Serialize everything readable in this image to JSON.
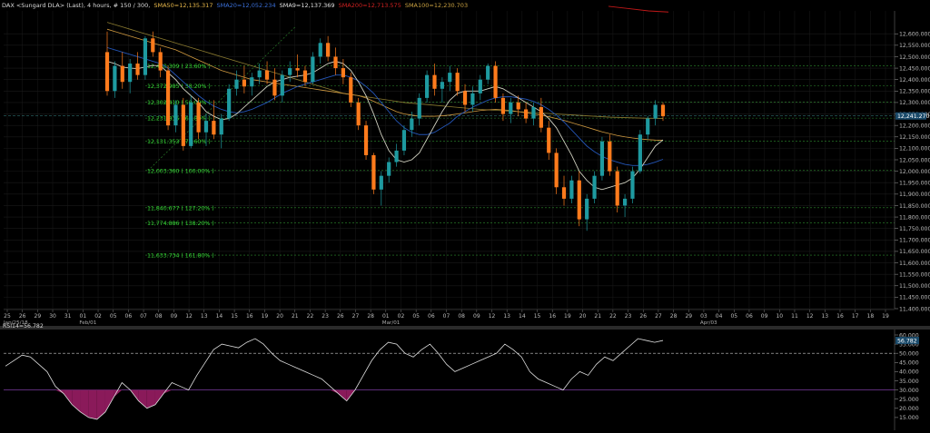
{
  "header": {
    "parts": [
      {
        "text": "DAX <Sungard DLA> (Last), 4 hours, # 150 / 300,",
        "color": "#d8d8d8"
      },
      {
        "text": "SMA50=12,135.317",
        "color": "#e8b84a"
      },
      {
        "text": "SMA20=12,052.234",
        "color": "#3a6fd8"
      },
      {
        "text": "SMA9=12,137.369",
        "color": "#e0e0e0"
      },
      {
        "text": "SMA200=12,713.575",
        "color": "#d02020"
      },
      {
        "text": "SMA100=12,230.703",
        "color": "#c8a040"
      }
    ]
  },
  "colors": {
    "bull": "#1e9aa0",
    "bear": "#ff7b1c",
    "sma9": "#d0d0c0",
    "sma20": "#2456b8",
    "sma50": "#d09a40",
    "sma100": "#8a7a30",
    "sma200": "#c01818",
    "fib": "#2e8b2e",
    "fib_label": "#36d636",
    "grid": "#1a1a1a",
    "rsi": "#e0e0e0",
    "rsi_fill": "#8a1a5a",
    "rsi_level": "#7a3aa0"
  },
  "chart_data": [
    {
      "type": "candlestick",
      "title": "DAX <Sungard DLA> (Last), 4 hours",
      "ylim": [
        11400,
        12700
      ],
      "y_ticks": [
        11400,
        11450,
        11500,
        11550,
        11600,
        11650,
        11700,
        11750,
        11800,
        11850,
        11900,
        11950,
        12000,
        12050,
        12100,
        12150,
        12200,
        12250,
        12300,
        12350,
        12400,
        12450,
        12500,
        12550,
        12600
      ],
      "y_tick_labels": [
        "11,400.000",
        "11,450.000",
        "11,500.000",
        "11,550.000",
        "11,600.000",
        "11,650.000",
        "11,700.000",
        "11,750.000",
        "11,800.000",
        "11,850.000",
        "11,900.000",
        "11,950.000",
        "12,000.000",
        "12,050.000",
        "12,100.000",
        "12,150.000",
        "12,200.000",
        "12,250.000",
        "12,300.000",
        "12,350.000",
        "12,400.000",
        "12,450.000",
        "12,500.000",
        "12,550.000",
        "12,600.000"
      ],
      "last_price": 12241.27,
      "last_price_label": "12,241.270",
      "x_day_labels": [
        "25",
        "26",
        "29",
        "30",
        "31",
        "01",
        "02",
        "05",
        "06",
        "07",
        "08",
        "09",
        "12",
        "13",
        "14",
        "15",
        "16",
        "19",
        "20",
        "21",
        "22",
        "23",
        "26",
        "27",
        "28",
        "01",
        "02",
        "05",
        "06",
        "07",
        "08",
        "09",
        "12",
        "13",
        "14",
        "15",
        "16",
        "19",
        "20",
        "21",
        "22",
        "23",
        "26",
        "27",
        "28",
        "29",
        "03",
        "04",
        "05",
        "06",
        "09",
        "10",
        "11",
        "12",
        "13",
        "16",
        "17",
        "18",
        "19"
      ],
      "x_month_labels": [
        {
          "text": "Jan/25/18",
          "day_index": 0
        },
        {
          "text": "Feb/01",
          "day_index": 5
        },
        {
          "text": "Mar/01",
          "day_index": 25
        },
        {
          "text": "Apr/03",
          "day_index": 46
        }
      ],
      "fib_levels": [
        {
          "price": 12460.309,
          "label": "12,460.309 ( 23.60% )"
        },
        {
          "price": 12372.985,
          "label": "12,372.985 ( 38.20% )"
        },
        {
          "price": 12302.41,
          "label": "12,302.410 ( 50.00% )"
        },
        {
          "price": 12231.835,
          "label": "12,231.835 ( 61.80% )"
        },
        {
          "price": 12131.353,
          "label": "12,131.353 ( 78.60% )"
        },
        {
          "price": 12003.36,
          "label": "12,003.360 ( 100.00% )"
        },
        {
          "price": 11840.677,
          "label": "11,840.677 ( 127.20% )"
        },
        {
          "price": 11774.886,
          "label": "11,774.886 ( 138.20% )"
        },
        {
          "price": 11633.734,
          "label": "11,633.734 ( 161.80% )"
        }
      ],
      "candles": [
        [
          12520,
          12610,
          12330,
          12350
        ],
        [
          12350,
          12480,
          12320,
          12460
        ],
        [
          12460,
          12520,
          12360,
          12390
        ],
        [
          12390,
          12490,
          12340,
          12470
        ],
        [
          12470,
          12520,
          12400,
          12420
        ],
        [
          12420,
          12590,
          12400,
          12580
        ],
        [
          12580,
          12610,
          12500,
          12520
        ],
        [
          12520,
          12540,
          12410,
          12440
        ],
        [
          12440,
          12460,
          12180,
          12200
        ],
        [
          12200,
          12310,
          12170,
          12290
        ],
        [
          12290,
          12320,
          12090,
          12110
        ],
        [
          12110,
          12330,
          12100,
          12300
        ],
        [
          12300,
          12320,
          12140,
          12170
        ],
        [
          12170,
          12250,
          12110,
          12220
        ],
        [
          12220,
          12310,
          12140,
          12160
        ],
        [
          12160,
          12250,
          12100,
          12230
        ],
        [
          12230,
          12380,
          12220,
          12360
        ],
        [
          12360,
          12440,
          12330,
          12400
        ],
        [
          12400,
          12460,
          12340,
          12370
        ],
        [
          12370,
          12430,
          12330,
          12410
        ],
        [
          12410,
          12470,
          12380,
          12440
        ],
        [
          12440,
          12480,
          12380,
          12400
        ],
        [
          12400,
          12450,
          12310,
          12330
        ],
        [
          12330,
          12440,
          12300,
          12420
        ],
        [
          12420,
          12480,
          12390,
          12450
        ],
        [
          12450,
          12510,
          12410,
          12440
        ],
        [
          12440,
          12460,
          12370,
          12390
        ],
        [
          12390,
          12520,
          12380,
          12500
        ],
        [
          12500,
          12580,
          12470,
          12560
        ],
        [
          12560,
          12590,
          12480,
          12500
        ],
        [
          12500,
          12540,
          12420,
          12450
        ],
        [
          12450,
          12490,
          12380,
          12410
        ],
        [
          12410,
          12430,
          12280,
          12300
        ],
        [
          12300,
          12320,
          12180,
          12200
        ],
        [
          12200,
          12220,
          12050,
          12070
        ],
        [
          12070,
          12080,
          11900,
          11920
        ],
        [
          11920,
          12000,
          11850,
          11980
        ],
        [
          11980,
          12060,
          11950,
          12040
        ],
        [
          12040,
          12120,
          12020,
          12090
        ],
        [
          12090,
          12200,
          12070,
          12180
        ],
        [
          12180,
          12260,
          12150,
          12230
        ],
        [
          12230,
          12340,
          12200,
          12320
        ],
        [
          12320,
          12440,
          12300,
          12420
        ],
        [
          12420,
          12470,
          12330,
          12360
        ],
        [
          12360,
          12410,
          12300,
          12390
        ],
        [
          12390,
          12460,
          12350,
          12430
        ],
        [
          12430,
          12450,
          12330,
          12350
        ],
        [
          12350,
          12380,
          12260,
          12290
        ],
        [
          12290,
          12370,
          12260,
          12340
        ],
        [
          12340,
          12420,
          12310,
          12400
        ],
        [
          12400,
          12470,
          12380,
          12460
        ],
        [
          12460,
          12480,
          12300,
          12320
        ],
        [
          12320,
          12340,
          12220,
          12250
        ],
        [
          12250,
          12320,
          12210,
          12300
        ],
        [
          12300,
          12330,
          12240,
          12270
        ],
        [
          12270,
          12300,
          12210,
          12230
        ],
        [
          12230,
          12300,
          12200,
          12280
        ],
        [
          12280,
          12320,
          12170,
          12190
        ],
        [
          12190,
          12220,
          12050,
          12080
        ],
        [
          12080,
          12100,
          11900,
          11930
        ],
        [
          11930,
          11980,
          11850,
          11880
        ],
        [
          11880,
          11980,
          11860,
          11960
        ],
        [
          11960,
          12000,
          11760,
          11790
        ],
        [
          11790,
          11900,
          11740,
          11880
        ],
        [
          11880,
          12000,
          11860,
          11980
        ],
        [
          11980,
          12150,
          11960,
          12130
        ],
        [
          12130,
          12160,
          11980,
          12000
        ],
        [
          12000,
          12020,
          11820,
          11850
        ],
        [
          11850,
          11900,
          11800,
          11880
        ],
        [
          11880,
          12020,
          11860,
          12000
        ],
        [
          12000,
          12180,
          11990,
          12160
        ],
        [
          12160,
          12240,
          12140,
          12230
        ],
        [
          12230,
          12310,
          12200,
          12290
        ],
        [
          12290,
          12300,
          12220,
          12240
        ]
      ],
      "sma9": [
        12480,
        12470,
        12455,
        12450,
        12448,
        12455,
        12462,
        12460,
        12430,
        12400,
        12360,
        12330,
        12300,
        12260,
        12240,
        12225,
        12230,
        12250,
        12280,
        12310,
        12340,
        12370,
        12390,
        12400,
        12410,
        12415,
        12420,
        12430,
        12450,
        12470,
        12480,
        12470,
        12440,
        12390,
        12330,
        12250,
        12160,
        12090,
        12050,
        12040,
        12050,
        12080,
        12140,
        12200,
        12260,
        12310,
        12340,
        12350,
        12350,
        12350,
        12360,
        12370,
        12360,
        12340,
        12320,
        12300,
        12280,
        12260,
        12230,
        12190,
        12130,
        12070,
        12000,
        11960,
        11930,
        11920,
        11930,
        11940,
        11950,
        11970,
        12010,
        12060,
        12110,
        12137
      ],
      "sma20": [
        12540,
        12530,
        12520,
        12510,
        12500,
        12490,
        12480,
        12470,
        12450,
        12420,
        12390,
        12360,
        12330,
        12305,
        12285,
        12270,
        12260,
        12255,
        12260,
        12270,
        12285,
        12300,
        12320,
        12340,
        12355,
        12370,
        12380,
        12390,
        12400,
        12410,
        12420,
        12420,
        12410,
        12395,
        12370,
        12340,
        12300,
        12260,
        12220,
        12190,
        12170,
        12160,
        12160,
        12170,
        12190,
        12210,
        12240,
        12260,
        12280,
        12295,
        12310,
        12320,
        12325,
        12325,
        12320,
        12315,
        12305,
        12290,
        12270,
        12245,
        12215,
        12180,
        12145,
        12110,
        12085,
        12065,
        12050,
        12040,
        12030,
        12025,
        12025,
        12030,
        12040,
        12052
      ],
      "sma50": [
        12620,
        12610,
        12600,
        12590,
        12580,
        12570,
        12560,
        12550,
        12540,
        12530,
        12515,
        12500,
        12485,
        12470,
        12455,
        12440,
        12430,
        12420,
        12410,
        12400,
        12395,
        12390,
        12385,
        12380,
        12375,
        12370,
        12365,
        12360,
        12355,
        12350,
        12345,
        12340,
        12335,
        12330,
        12320,
        12305,
        12290,
        12275,
        12260,
        12250,
        12245,
        12240,
        12240,
        12240,
        12242,
        12245,
        12250,
        12255,
        12260,
        12265,
        12268,
        12270,
        12268,
        12265,
        12260,
        12255,
        12250,
        12245,
        12238,
        12230,
        12222,
        12212,
        12202,
        12192,
        12182,
        12172,
        12164,
        12156,
        12150,
        12145,
        12141,
        12138,
        12136,
        12135
      ],
      "sma100": [
        12650,
        12640,
        12630,
        12620,
        12610,
        12600,
        12590,
        12580,
        12570,
        12560,
        12550,
        12540,
        12530,
        12520,
        12510,
        12500,
        12490,
        12480,
        12470,
        12460,
        12450,
        12440,
        12430,
        12420,
        12410,
        12400,
        12390,
        12380,
        12370,
        12360,
        12350,
        12340,
        12335,
        12330,
        12325,
        12320,
        12315,
        12310,
        12305,
        12300,
        12297,
        12294,
        12291,
        12288,
        12285,
        12282,
        12279,
        12276,
        12273,
        12270,
        12268,
        12266,
        12264,
        12262,
        12260,
        12258,
        12256,
        12254,
        12252,
        12250,
        12248,
        12246,
        12244,
        12242,
        12240,
        12238,
        12236,
        12235,
        12234,
        12233,
        12232,
        12231,
        12231,
        12230
      ],
      "sma200_visible": [
        [
          0,
          12720
        ],
        [
          1,
          12710
        ],
        [
          2,
          12700
        ],
        [
          3,
          12695
        ]
      ],
      "rsi": {
        "label": "RSI14=56.782",
        "value_label": "56.782",
        "ylim": [
          10,
          60
        ],
        "levels": [
          50,
          30
        ],
        "y_tick_labels": [
          "60.000",
          "55.000",
          "50.000",
          "45.000",
          "40.000",
          "35.000",
          "30.000",
          "25.000",
          "20.000",
          "15.000"
        ],
        "values": [
          43,
          46,
          49,
          48,
          44,
          40,
          32,
          28,
          22,
          18,
          15,
          14,
          18,
          26,
          34,
          30,
          24,
          20,
          22,
          28,
          34,
          32,
          30,
          38,
          45,
          52,
          55,
          54,
          53,
          56,
          58,
          55,
          50,
          46,
          44,
          42,
          40,
          38,
          36,
          32,
          28,
          24,
          30,
          38,
          46,
          52,
          56,
          55,
          50,
          48,
          52,
          55,
          50,
          44,
          40,
          42,
          44,
          46,
          48,
          50,
          55,
          52,
          48,
          40,
          36,
          34,
          32,
          30,
          36,
          40,
          38,
          44,
          48,
          46,
          50,
          54,
          58,
          57,
          56,
          57
        ]
      }
    }
  ]
}
